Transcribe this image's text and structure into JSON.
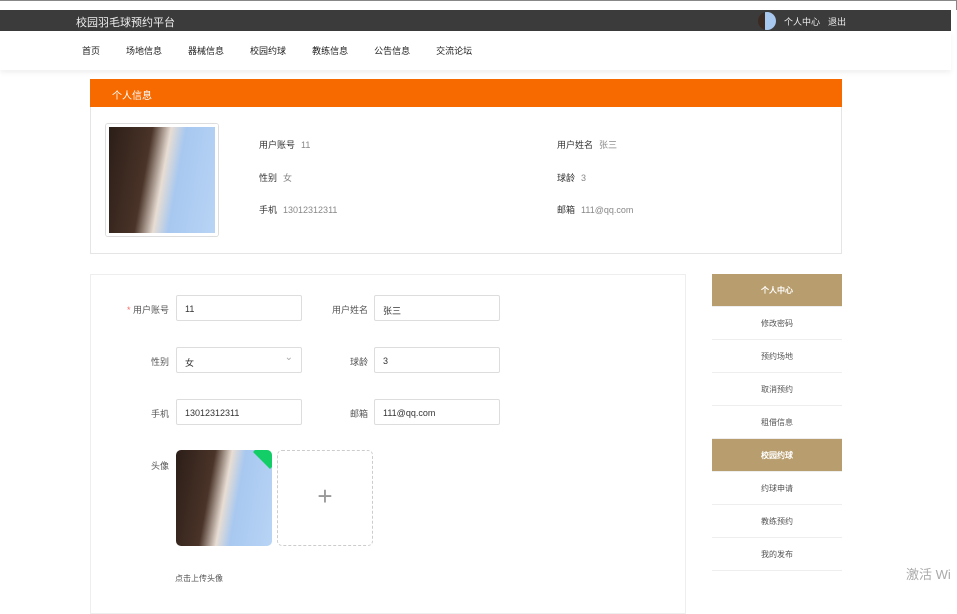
{
  "header": {
    "title": "校园羽毛球预约平台",
    "user_center": "个人中心",
    "logout": "退出"
  },
  "nav": [
    "首页",
    "场地信息",
    "器械信息",
    "校园约球",
    "教练信息",
    "公告信息",
    "交流论坛"
  ],
  "profile": {
    "heading": "个人信息",
    "fields": [
      {
        "label": "用户账号",
        "value": "11"
      },
      {
        "label": "用户姓名",
        "value": "张三"
      },
      {
        "label": "性别",
        "value": "女"
      },
      {
        "label": "球龄",
        "value": "3"
      },
      {
        "label": "手机",
        "value": "13012312311"
      },
      {
        "label": "邮箱",
        "value": "111@qq.com"
      }
    ]
  },
  "form": {
    "required_mark": "*",
    "account_label": "用户账号",
    "account": "11",
    "name_label": "用户姓名",
    "name": "张三",
    "gender_label": "性别",
    "gender": "女",
    "age_label": "球龄",
    "age": "3",
    "phone_label": "手机",
    "phone": "13012312311",
    "email_label": "邮箱",
    "email": "111@qq.com",
    "avatar_label": "头像",
    "add": "+",
    "upload_hint": "点击上传头像"
  },
  "sidebar": [
    {
      "label": "个人中心",
      "active": true
    },
    {
      "label": "修改密码"
    },
    {
      "label": "预约场地"
    },
    {
      "label": "取消预约"
    },
    {
      "label": "租借信息"
    },
    {
      "label": "校园约球",
      "active": true
    },
    {
      "label": "约球申请"
    },
    {
      "label": "教练预约"
    },
    {
      "label": "我的发布"
    }
  ],
  "watermark": "激活 Wi",
  "colors": {
    "accent": "#f66a00",
    "sidebar_active": "#b89d6e",
    "topbar": "#3b3b3b"
  }
}
